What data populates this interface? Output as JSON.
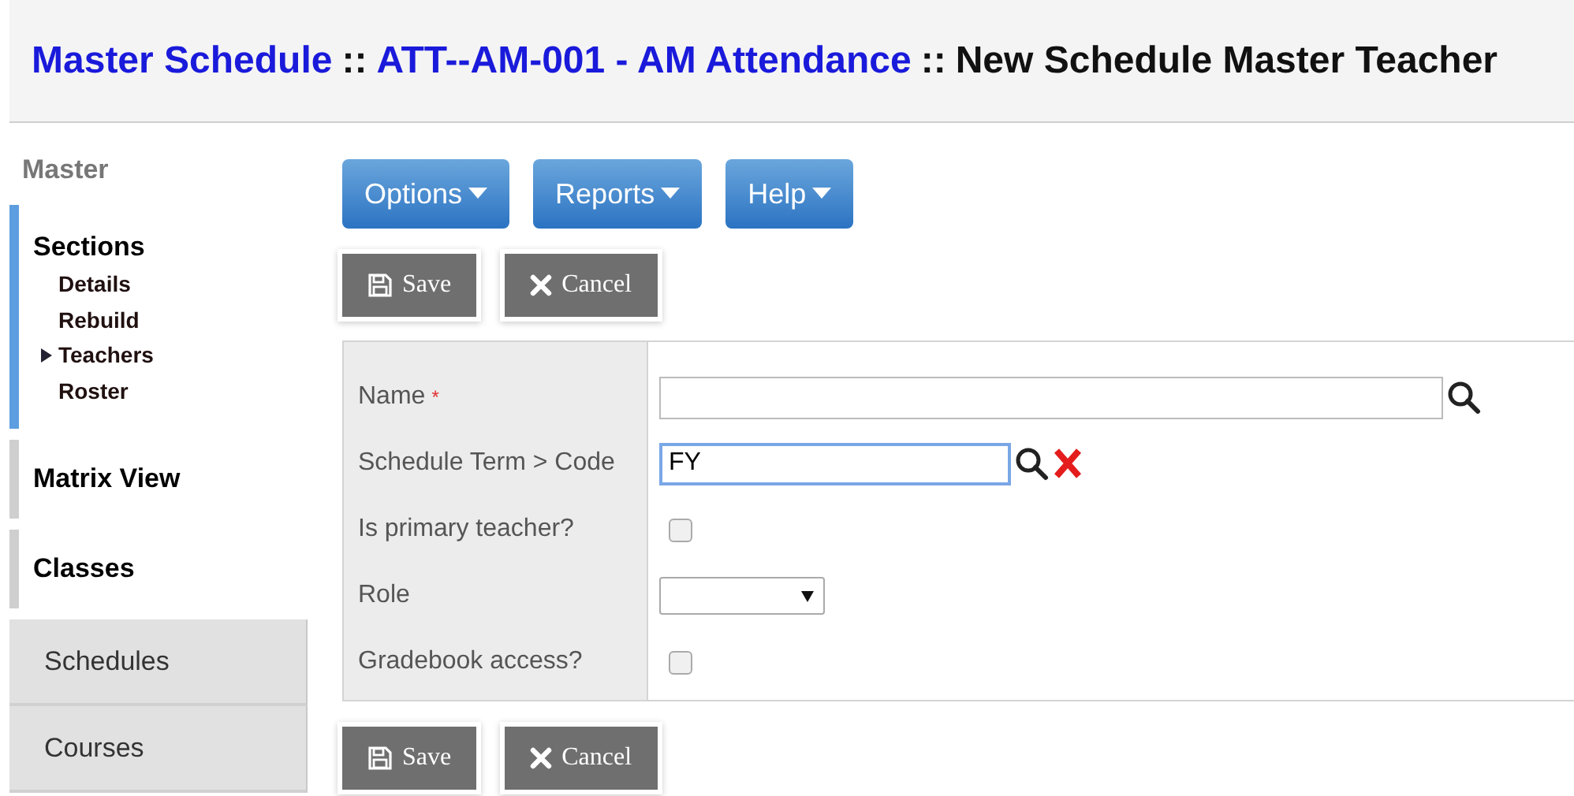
{
  "breadcrumb": [
    {
      "text": "Master Schedule",
      "kind": "link"
    },
    {
      "text": "::",
      "kind": "separator"
    },
    {
      "text": "ATT--AM-001 - AM Attendance",
      "kind": "link"
    },
    {
      "text": "::",
      "kind": "separator"
    },
    {
      "text": "New Schedule Master Teacher",
      "kind": "current"
    }
  ],
  "sidebar": {
    "title": "Master",
    "groups": [
      {
        "label": "Sections",
        "kind": "group",
        "selected": true,
        "children": [
          {
            "label": "Details",
            "selected": false
          },
          {
            "label": "Rebuild",
            "selected": false
          },
          {
            "label": "Teachers",
            "selected": true
          },
          {
            "label": "Roster",
            "selected": false
          }
        ]
      },
      {
        "label": "Matrix View",
        "kind": "group",
        "selected": false
      },
      {
        "label": "Classes",
        "kind": "group",
        "selected": false
      },
      {
        "label": "Schedules",
        "kind": "tab",
        "selected": false
      },
      {
        "label": "Courses",
        "kind": "tab",
        "selected": false
      }
    ]
  },
  "menu_buttons": [
    "Options",
    "Reports",
    "Help"
  ],
  "top_actions": [
    {
      "label": "Save",
      "kind": "save"
    },
    {
      "label": "Cancel",
      "kind": "cancel"
    }
  ],
  "form": [
    {
      "label": "Name",
      "required_mark": "*",
      "kind": "lookup",
      "clearable": false
    },
    {
      "label": "Schedule Term > Code",
      "kind": "lookup",
      "value": "FY",
      "clearable": true
    },
    {
      "label": "Is primary teacher?",
      "kind": "checkbox",
      "checked": false
    },
    {
      "label": "Role",
      "kind": "select"
    },
    {
      "label": "Gradebook access?",
      "kind": "checkbox",
      "checked": false
    }
  ],
  "bottom_actions": [
    {
      "label": "Save",
      "kind": "save"
    },
    {
      "label": "Cancel",
      "kind": "cancel"
    }
  ]
}
